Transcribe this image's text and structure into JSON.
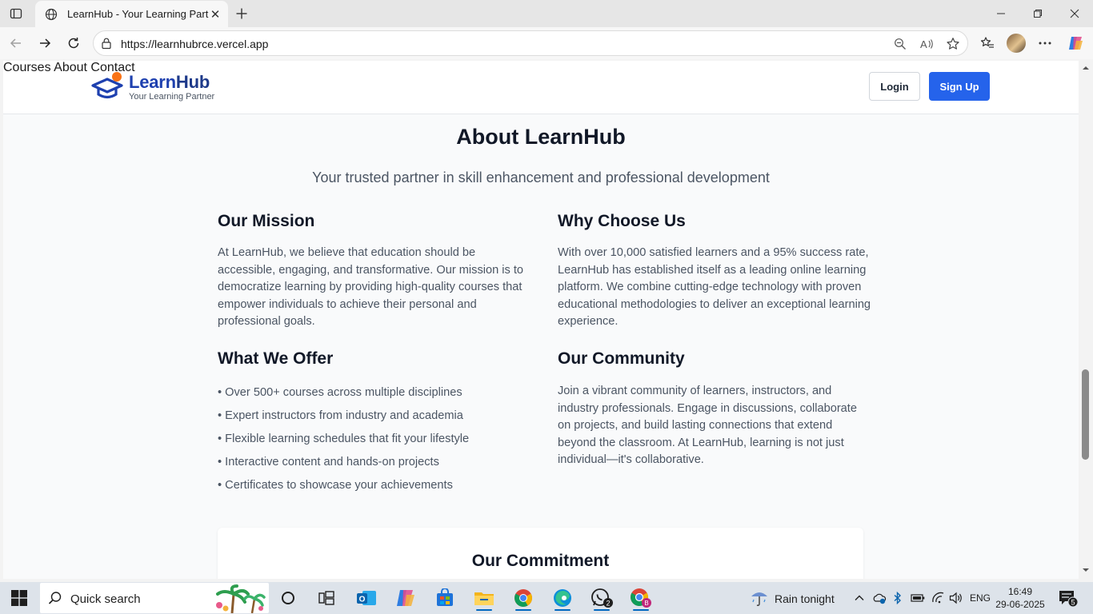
{
  "browser": {
    "tab_title": "LearnHub - Your Learning Partner",
    "url": "https://learnhubrce.vercel.app"
  },
  "site": {
    "brand_learn": "Learn",
    "brand_hub": "Hub",
    "tagline": "Your Learning Partner",
    "nav": [
      "Courses",
      "About",
      "Contact"
    ],
    "login_label": "Login",
    "signup_label": "Sign Up"
  },
  "about": {
    "title": "About LearnHub",
    "subtitle": "Your trusted partner in skill enhancement and professional development",
    "mission_title": "Our Mission",
    "mission_text": "At LearnHub, we believe that education should be accessible, engaging, and transformative. Our mission is to democratize learning by providing high-quality courses that empower individuals to achieve their personal and professional goals.",
    "why_title": "Why Choose Us",
    "why_text": "With over 10,000 satisfied learners and a 95% success rate, LearnHub has established itself as a leading online learning platform. We combine cutting-edge technology with proven educational methodologies to deliver an exceptional learning experience.",
    "offer_title": "What We Offer",
    "offer_items": [
      "• Over 500+ courses across multiple disciplines",
      "• Expert instructors from industry and academia",
      "• Flexible learning schedules that fit your lifestyle",
      "• Interactive content and hands-on projects",
      "• Certificates to showcase your achievements"
    ],
    "community_title": "Our Community",
    "community_text": "Join a vibrant community of learners, instructors, and industry professionals. Engage in discussions, collaborate on projects, and build lasting connections that extend beyond the classroom. At LearnHub, learning is not just individual—it's collaborative.",
    "commitment_title": "Our Commitment"
  },
  "taskbar": {
    "search_label": "Quick search",
    "weather_text": "Rain tonight",
    "language": "ENG",
    "time": "16:49",
    "date": "29-06-2025",
    "whatsapp_badge": "2",
    "notification_badge": "5"
  },
  "colors": {
    "brand_blue": "#2563eb",
    "brand_orange": "#f97316",
    "page_bg": "#f9fafb"
  },
  "icons": [
    "tab-actions-icon",
    "globe-icon",
    "close-icon",
    "plus-icon",
    "minimize-icon",
    "restore-icon",
    "back-icon",
    "forward-icon",
    "refresh-icon",
    "lock-icon",
    "zoom-icon",
    "read-aloud-icon",
    "favorite-icon",
    "favorites-icon",
    "more-icon",
    "copilot-icon",
    "windows-icon",
    "search-icon",
    "cortana-icon",
    "task-view-icon",
    "outlook-icon",
    "copilot-app-icon",
    "store-icon",
    "file-explorer-icon",
    "chrome-icon",
    "edge-icon",
    "whatsapp-icon",
    "chrome-profile-icon",
    "weather-icon",
    "chevron-up-icon",
    "onedrive-icon",
    "bluetooth-icon",
    "battery-icon",
    "wifi-icon",
    "volume-icon",
    "notification-icon"
  ]
}
